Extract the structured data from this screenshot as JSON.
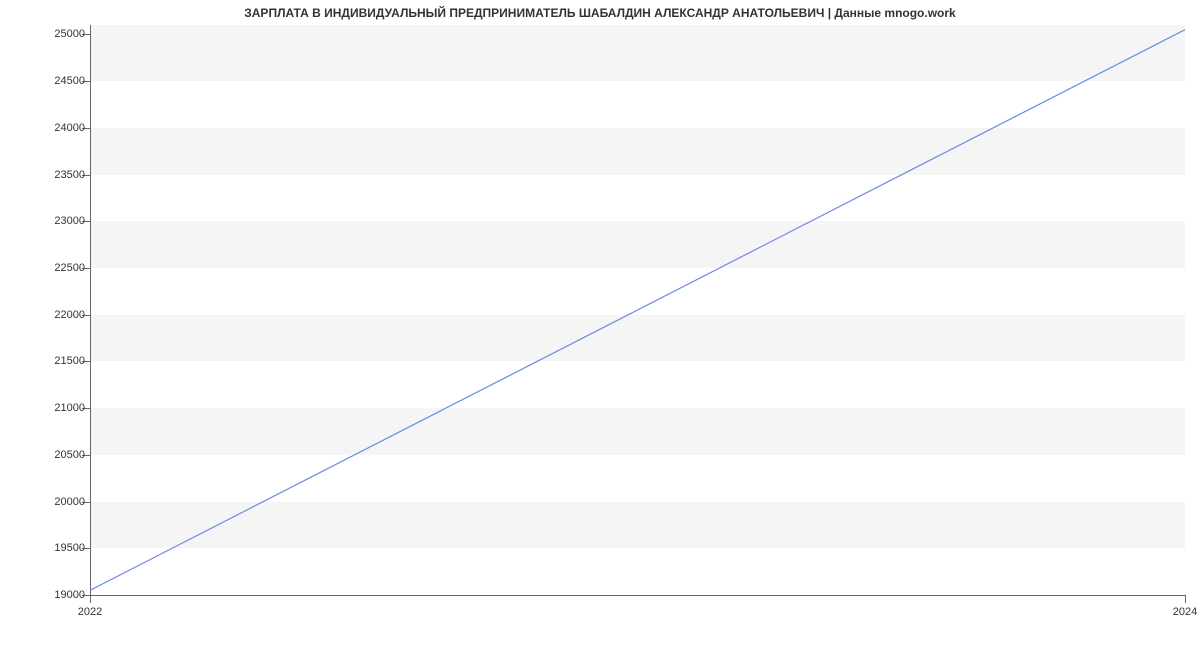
{
  "chart_data": {
    "type": "line",
    "title": "ЗАРПЛАТА В ИНДИВИДУАЛЬНЫЙ ПРЕДПРИНИМАТЕЛЬ ШАБАЛДИН АЛЕКСАНДР АНАТОЛЬЕВИЧ | Данные mnogo.work",
    "xlabel": "",
    "ylabel": "",
    "x_categories": [
      "2022",
      "2024"
    ],
    "x": [
      2022,
      2024
    ],
    "values": [
      19050,
      25050
    ],
    "y_ticks": [
      19000,
      19500,
      20000,
      20500,
      21000,
      21500,
      22000,
      22500,
      23000,
      23500,
      24000,
      24500,
      25000
    ],
    "x_ticks": [
      "2022",
      "2024"
    ],
    "ylim": [
      19000,
      25100
    ],
    "xlim": [
      2022,
      2024
    ],
    "grid": true
  }
}
